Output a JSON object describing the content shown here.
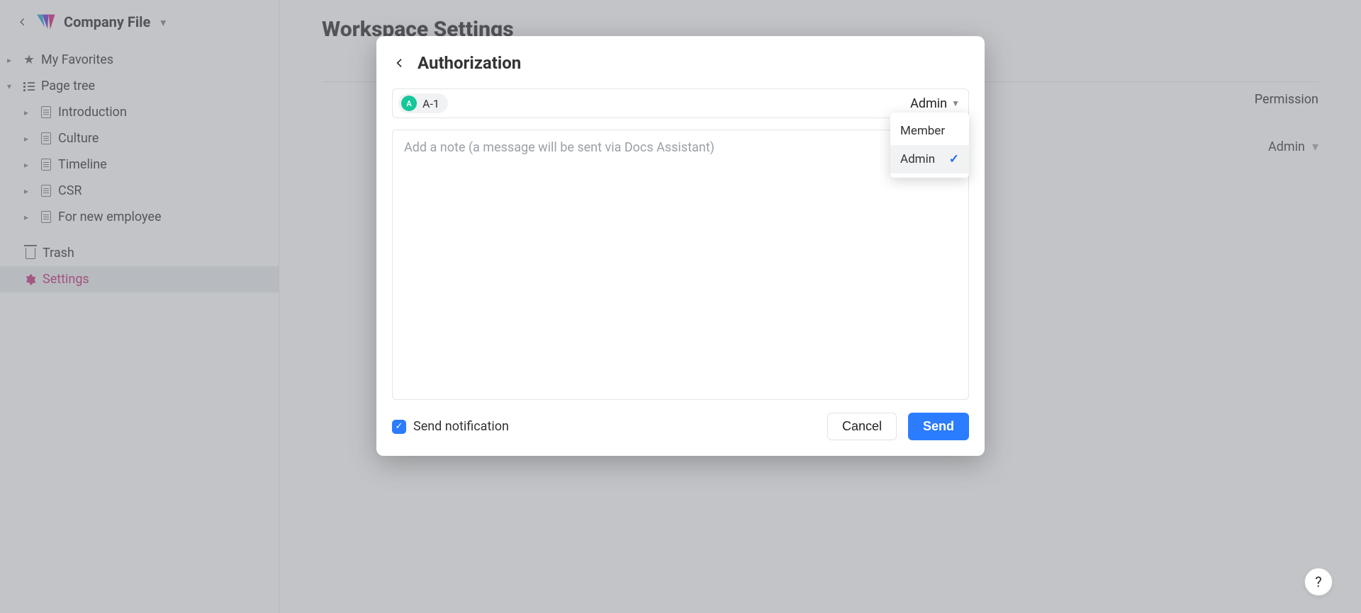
{
  "workspace": {
    "name": "Company File"
  },
  "sidebar": {
    "favorites": {
      "label": "My Favorites"
    },
    "pagetree": {
      "label": "Page tree"
    },
    "pages": [
      {
        "label": "Introduction"
      },
      {
        "label": "Culture"
      },
      {
        "label": "Timeline"
      },
      {
        "label": "CSR"
      },
      {
        "label": "For new employee"
      }
    ],
    "trash": {
      "label": "Trash"
    },
    "settings": {
      "label": "Settings"
    }
  },
  "main": {
    "title": "Workspace Settings",
    "permission_header": "Permission",
    "row_permission": "Admin"
  },
  "modal": {
    "title": "Authorization",
    "user": {
      "avatar_initial": "A",
      "label": "A-1"
    },
    "role": {
      "selected": "Admin",
      "options": [
        "Member",
        "Admin"
      ]
    },
    "note_placeholder": "Add a note (a message will be sent via Docs Assistant)",
    "send_notification_label": "Send notification",
    "cancel": "Cancel",
    "send": "Send"
  }
}
